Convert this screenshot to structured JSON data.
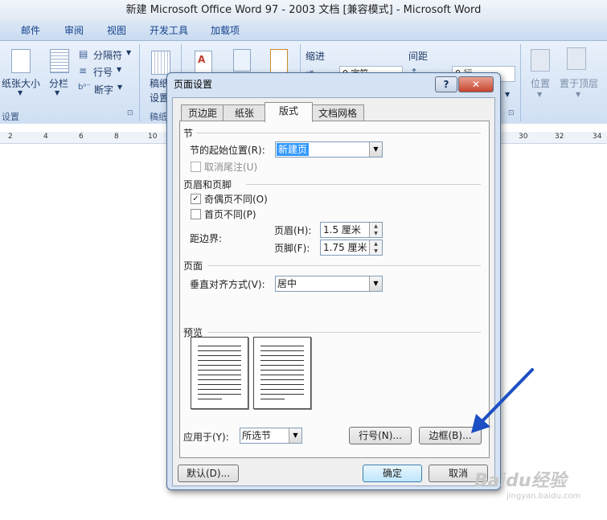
{
  "window": {
    "title": "新建 Microsoft Office Word 97 - 2003 文档 [兼容模式] - Microsoft Word"
  },
  "ribbon": {
    "tabs": [
      "邮件",
      "审阅",
      "视图",
      "开发工具",
      "加载项"
    ],
    "page_setup": {
      "paper_size": "纸张大小",
      "columns": "分栏",
      "breaks": "分隔符",
      "line_numbers": "行号",
      "hyphenation": "断字",
      "group_caption": "设置"
    },
    "draft_group": {
      "label_line1": "稿纸",
      "label_line2": "设置",
      "caption": "稿纸"
    },
    "paragraph": {
      "indent_label": "缩进",
      "spacing_label": "间距",
      "indent_value": "0 字符",
      "spacing_value": "0 行"
    },
    "arrange": {
      "position": "位置",
      "bring_front": "置于顶层"
    }
  },
  "ruler": {
    "ticks": [
      "2",
      "4",
      "6",
      "8",
      "10",
      "30",
      "32",
      "34"
    ]
  },
  "dialog": {
    "title": "页面设置",
    "help_button": "?",
    "close_button": "✕",
    "tabs": [
      "页边距",
      "纸张",
      "版式",
      "文档网格"
    ],
    "active_tab": "版式",
    "section": {
      "heading": "节",
      "start_label": "节的起始位置(R):",
      "start_value": "新建页",
      "suppress_endnotes": "取消尾注(U)",
      "suppress_endnotes_checked": false
    },
    "headers_footers": {
      "heading": "页眉和页脚",
      "odd_even": "奇偶页不同(O)",
      "odd_even_checked": true,
      "first_page": "首页不同(P)",
      "first_page_checked": false,
      "from_edge_label": "距边界:",
      "header_label": "页眉(H):",
      "header_value": "1.5 厘米",
      "footer_label": "页脚(F):",
      "footer_value": "1.75 厘米"
    },
    "page": {
      "heading": "页面",
      "vertical_alignment_label": "垂直对齐方式(V):",
      "vertical_alignment_value": "居中"
    },
    "preview": {
      "heading": "预览"
    },
    "apply_to": {
      "label": "应用于(Y):",
      "value": "所选节"
    },
    "buttons": {
      "line_numbers": "行号(N)...",
      "borders": "边框(B)...",
      "default": "默认(D)...",
      "ok": "确定",
      "cancel": "取消"
    }
  },
  "overlay": {
    "arrow_color": "#1c4fc4"
  },
  "watermark": {
    "text": "Baidu经验",
    "subtext": "jingyan.baidu.com"
  }
}
